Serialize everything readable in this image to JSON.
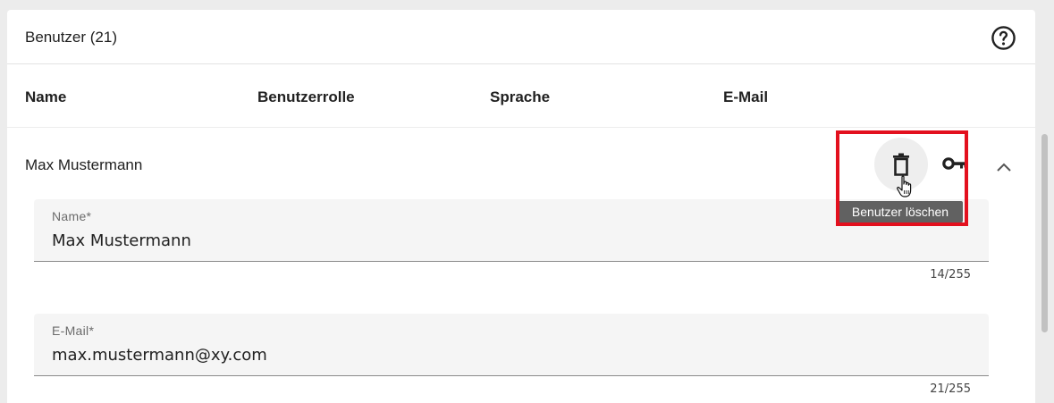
{
  "header": {
    "title": "Benutzer (21)",
    "help_icon": "help-circle-icon"
  },
  "table": {
    "columns": [
      "Name",
      "Benutzerrolle",
      "Sprache",
      "E-Mail"
    ]
  },
  "user_row": {
    "name": "Max Mustermann",
    "actions": {
      "delete_icon": "trash-icon",
      "key_icon": "key-icon",
      "collapse_icon": "chevron-up-icon",
      "delete_tooltip": "Benutzer löschen"
    }
  },
  "form": {
    "name_field": {
      "label": "Name*",
      "value": "Max Mustermann",
      "counter": "14/255"
    },
    "email_field": {
      "label": "E-Mail*",
      "value": "max.mustermann@xy.com",
      "counter": "21/255"
    }
  },
  "colors": {
    "highlight": "#e3101e",
    "tooltip_bg": "#616161",
    "field_bg": "#f5f5f5"
  }
}
